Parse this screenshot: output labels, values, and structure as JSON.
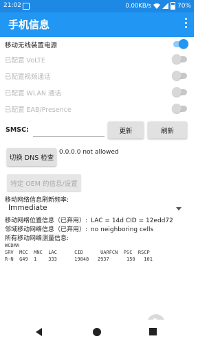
{
  "status_bar": {
    "time": "21:02",
    "speed": "0.00KB/s",
    "battery": "70%",
    "icons": [
      "image-notification-icon",
      "wifi-icon",
      "signal-icon",
      "battery-icon"
    ]
  },
  "app_bar": {
    "title": "手机信息",
    "menu_icon": "overflow-menu-icon"
  },
  "toggles": [
    {
      "label": "移动无线装置电源",
      "enabled": true,
      "on": true
    },
    {
      "label": "已配置 VoLTE",
      "enabled": false,
      "on": false
    },
    {
      "label": "已配置视频通话",
      "enabled": false,
      "on": false
    },
    {
      "label": "已配置 WLAN 通话",
      "enabled": false,
      "on": false
    },
    {
      "label": "已配置 EAB/Presence",
      "enabled": false,
      "on": false
    }
  ],
  "smsc": {
    "label": "SMSC:",
    "value": "",
    "update_button": "更新",
    "refresh_button": "刷新"
  },
  "dns": {
    "button": "切换 DNS 检查",
    "result": "0.0.0.0 not allowed"
  },
  "oem": {
    "button": "特定 OEM 的信息/设置"
  },
  "refresh_rate": {
    "label": "移动网络信息刷新频率:",
    "selected": "Immediate"
  },
  "cell_info": {
    "location_key": "移动网络位置信息（已弃用）:",
    "location_value": "LAC = 14d   CID = 12edd72",
    "neighbor_key": "邻域移动网络信息（已弃用）:",
    "neighbor_value": "no neighboring cells",
    "all_key": "所有移动网络测量信息:",
    "measure_lines": [
      "WCDMA",
      "SRV  MCC  MNC  LAC      CID      UARFCN  PSC  RSCP",
      "R-N  G49  1    333      19848   2937      150   101"
    ]
  },
  "nav_bar": {
    "icons": [
      "back-icon",
      "home-icon",
      "recent-apps-icon"
    ]
  },
  "colors": {
    "status_bar": "#1e88e5",
    "app_bar": "#2196f3",
    "switch_on": "#2196f3"
  }
}
